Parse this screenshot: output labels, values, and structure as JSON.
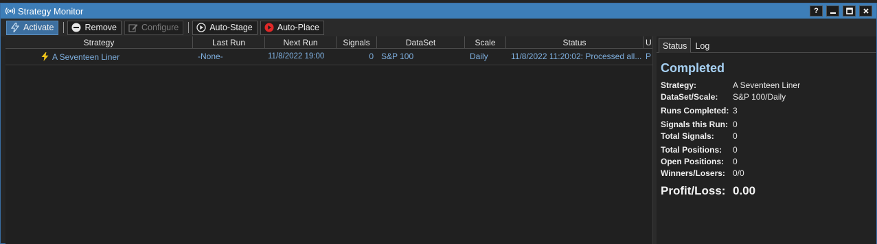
{
  "window": {
    "title": "Strategy Monitor"
  },
  "title_buttons": [
    "?",
    "▁",
    "▢",
    "✕"
  ],
  "toolbar": {
    "activate": "Activate",
    "remove": "Remove",
    "configure": "Configure",
    "auto_stage": "Auto-Stage",
    "auto_place": "Auto-Place"
  },
  "grid": {
    "columns": [
      "Strategy",
      "Last Run",
      "Next Run",
      "Signals",
      "DataSet",
      "Scale",
      "Status",
      "U"
    ],
    "rows": [
      {
        "strategy": "A Seventeen Liner",
        "last_run": "-None-",
        "next_run": "11/8/2022 19:00",
        "signals": "0",
        "dataset": "S&P 100",
        "scale": "Daily",
        "status": "11/8/2022 11:20:02: Processed all...",
        "u": "P"
      }
    ]
  },
  "tabs": [
    "Status",
    "Log"
  ],
  "status_panel": {
    "state": "Completed",
    "fields": [
      {
        "label": "Strategy:",
        "value": "A Seventeen Liner"
      },
      {
        "label": "DataSet/Scale:",
        "value": "S&P 100/Daily"
      },
      {
        "label": "Runs Completed:",
        "value": "3"
      },
      {
        "label": "Signals this Run:",
        "value": "0"
      },
      {
        "label": "Total Signals:",
        "value": "0"
      },
      {
        "label": "Total Positions:",
        "value": "0"
      },
      {
        "label": "Open Positions:",
        "value": "0"
      },
      {
        "label": "Winners/Losers:",
        "value": "0/0"
      }
    ],
    "profit_loss_label": "Profit/Loss:",
    "profit_loss_value": "0.00"
  },
  "colors": {
    "titlebar": "#3d7eb8",
    "active_button": "#3d6f9f",
    "row_text": "#7fb0e0",
    "completed_text": "#a6d0f2",
    "auto_place_icon": "#e02828"
  }
}
